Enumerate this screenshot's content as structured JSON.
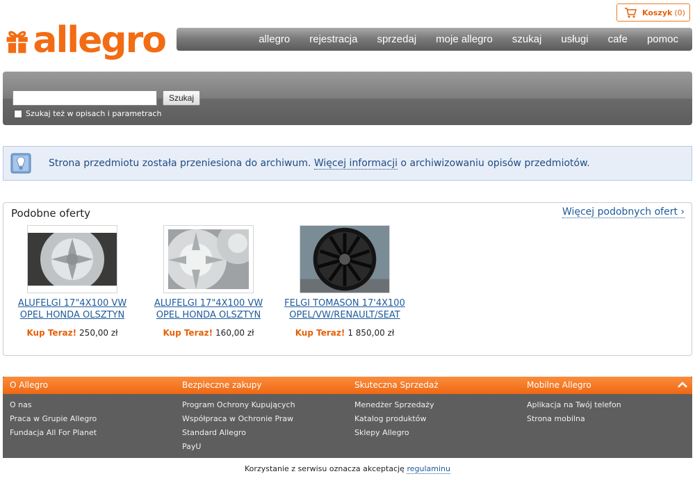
{
  "cart": {
    "label": "Koszyk",
    "count": "(0)"
  },
  "logo": {
    "text": "allegro"
  },
  "nav": {
    "items": [
      "allegro",
      "rejestracja",
      "sprzedaj",
      "moje allegro",
      "szukaj",
      "usługi",
      "cafe",
      "pomoc"
    ]
  },
  "search": {
    "value": "",
    "button": "Szukaj",
    "checkbox_label": "Szukaj też w opisach i parametrach",
    "checkbox_checked": false
  },
  "info": {
    "text_before": "Strona przedmiotu została przeniesiona do archiwum.",
    "link": "Więcej informacji",
    "text_after": "o archiwizowaniu opisów przedmiotów."
  },
  "similar": {
    "title": "Podobne oferty",
    "more_link": "Więcej podobnych ofert ›",
    "offers": [
      {
        "title": "ALUFELGI 17\"4X100 VW OPEL HONDA OLSZTYN",
        "buy_label": "Kup Teraz!",
        "price": "250,00 zł"
      },
      {
        "title": "ALUFELGI 17\"4X100 VW OPEL HONDA OLSZTYN",
        "buy_label": "Kup Teraz!",
        "price": "160,00 zł"
      },
      {
        "title": "FELGI TOMASON 17'4X100 OPEL/VW/RENAULT/SEAT",
        "buy_label": "Kup Teraz!",
        "price": "1 850,00 zł"
      }
    ]
  },
  "footer": {
    "columns": [
      {
        "title": "O Allegro",
        "links": [
          "O nas",
          "Praca w Grupie Allegro",
          "Fundacja All For Planet"
        ]
      },
      {
        "title": "Bezpieczne zakupy",
        "links": [
          "Program Ochrony Kupujących",
          "Współpraca w Ochronie Praw",
          "Standard Allegro",
          "PayU"
        ]
      },
      {
        "title": "Skuteczna Sprzedaż",
        "links": [
          "Menedżer Sprzedaży",
          "Katalog produktów",
          "Sklepy Allegro"
        ]
      },
      {
        "title": "Mobilne Allegro",
        "links": [
          "Aplikacja na Twój telefon",
          "Strona mobilna"
        ]
      }
    ]
  },
  "legal": {
    "text": "Korzystanie z serwisu oznacza akceptację",
    "link": "regulaminu"
  },
  "colors": {
    "brand_orange": "#f26c14",
    "link_blue": "#1e5a9c",
    "nav_gray": "#6b6b6b"
  }
}
